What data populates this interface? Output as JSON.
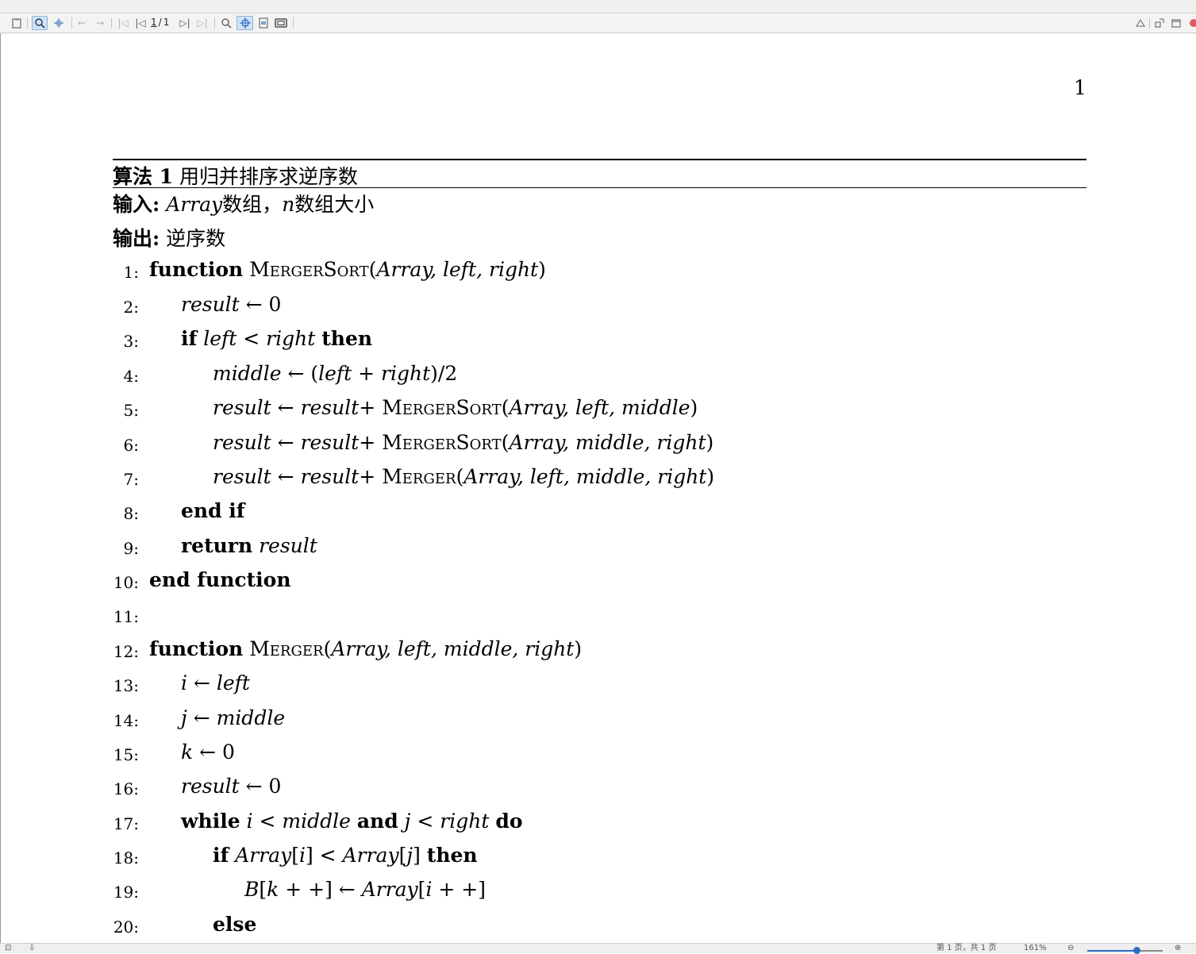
{
  "toolbar": {
    "page_current": "1",
    "page_sep": "/",
    "page_total": "1",
    "icons": [
      "clipboard-icon",
      "zoom-icon",
      "pan-icon",
      "back-arrow-icon",
      "forward-arrow-icon",
      "first-page-icon",
      "prev-page-icon",
      "next-page-icon",
      "last-page-icon",
      "magnifier-icon",
      "fit-width-icon",
      "fit-page-icon",
      "fullscreen-icon",
      "triangle-up-icon",
      "tile-icon",
      "window-icon",
      "close-icon"
    ],
    "glyphs": {
      "back": "←",
      "forward": "→",
      "first": "|◁",
      "prev": "◁",
      "next": "▷",
      "last": "▷|"
    }
  },
  "document": {
    "page_number": "1",
    "caption_label": "算法 1",
    "caption_text": " 用归并排序求逆序数",
    "input_label": "输入:",
    "input_var1": "Array",
    "input_text1": "数组，",
    "input_var2": "n",
    "input_text2": "数组大小",
    "output_label": "输出:",
    "output_text": " 逆序数",
    "lines": [
      {
        "no": "1:",
        "html": "<span class='b'>function</span> <span class='sc'>MergerSort</span>(<span class='i'>Array, left, right</span>)"
      },
      {
        "no": "2:",
        "html": "<span class='i'>result</span> ← 0"
      },
      {
        "no": "3:",
        "html": "<span class='b'>if</span> <span class='i'>left</span> &lt; <span class='i'>right</span> <span class='b'>then</span>"
      },
      {
        "no": "4:",
        "html": "<span class='i'>middle</span> ← (<span class='i'>left</span> + <span class='i'>right</span>)/2"
      },
      {
        "no": "5:",
        "html": "<span class='i'>result</span> ← <span class='i'>result</span>+ <span class='sc'>MergerSort</span>(<span class='i'>Array, left, middle</span>)"
      },
      {
        "no": "6:",
        "html": "<span class='i'>result</span> ← <span class='i'>result</span>+ <span class='sc'>MergerSort</span>(<span class='i'>Array, middle, right</span>)"
      },
      {
        "no": "7:",
        "html": "<span class='i'>result</span> ← <span class='i'>result</span>+ <span class='sc'>Merger</span>(<span class='i'>Array, left, middle, right</span>)"
      },
      {
        "no": "8:",
        "html": "<span class='b'>end if</span>"
      },
      {
        "no": "9:",
        "html": "<span class='b'>return</span> <span class='i'>result</span>"
      },
      {
        "no": "10:",
        "html": "<span class='b'>end function</span>"
      },
      {
        "no": "11:",
        "html": ""
      },
      {
        "no": "12:",
        "html": "<span class='b'>function</span> <span class='sc'>Merger</span>(<span class='i'>Array, left, middle, right</span>)"
      },
      {
        "no": "13:",
        "html": "<span class='i'>i</span> ← <span class='i'>left</span>"
      },
      {
        "no": "14:",
        "html": "<span class='i'>j</span> ← <span class='i'>middle</span>"
      },
      {
        "no": "15:",
        "html": "<span class='i'>k</span> ← 0"
      },
      {
        "no": "16:",
        "html": "<span class='i'>result</span> ← 0"
      },
      {
        "no": "17:",
        "html": "<span class='b'>while</span> <span class='i'>i</span> &lt; <span class='i'>middle</span> <span class='b'>and</span> <span class='i'>j</span> &lt; <span class='i'>right</span> <span class='b'>do</span>"
      },
      {
        "no": "18:",
        "html": "<span class='b'>if</span> <span class='i'>Array</span>[<span class='i'>i</span>] &lt; <span class='i'>Array</span>[<span class='i'>j</span>] <span class='b'>then</span>"
      },
      {
        "no": "19:",
        "html": "<span class='i'>B</span>[<span class='i'>k</span> + +] ← <span class='i'>Array</span>[<span class='i'>i</span> + +]"
      },
      {
        "no": "20:",
        "html": "<span class='b'>else</span>"
      }
    ]
  },
  "status": {
    "page_label": "第 1 页，共 1 页",
    "zoom": "161%",
    "zoom_out": "⊖",
    "zoom_in": "⊕"
  }
}
